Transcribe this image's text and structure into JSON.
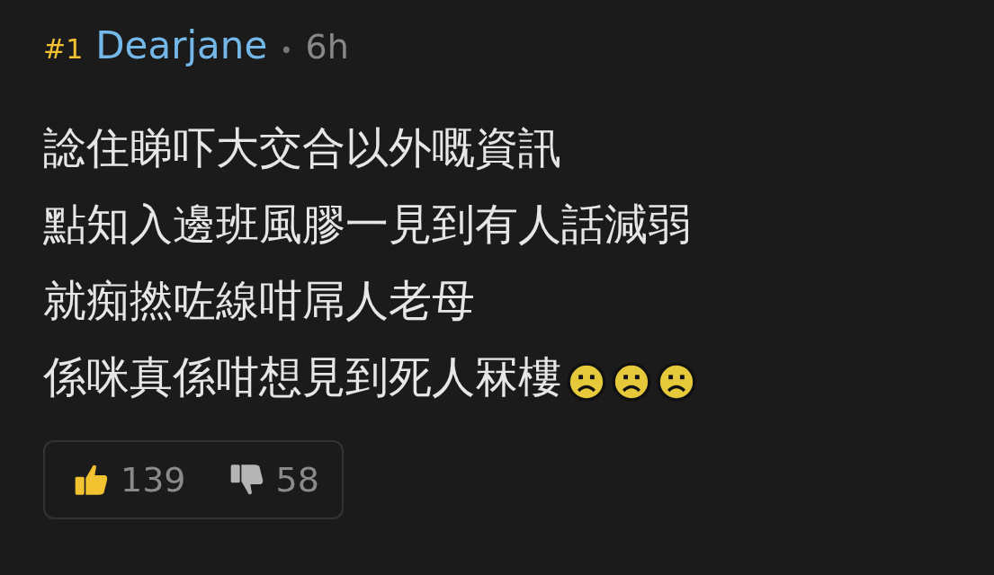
{
  "post": {
    "number": "#1",
    "author": "Dearjane",
    "separator": "•",
    "time": "6h",
    "lines": [
      {
        "text": "諗住睇吓大交合以外嘅資訊"
      },
      {
        "text": "點知入邊班風膠一見到有人話減弱"
      },
      {
        "text": "就痴撚咗線咁屌人老母"
      },
      {
        "text": "係咪真係咁想見到死人冧樓",
        "emoticons": [
          {
            "kind": "sad"
          },
          {
            "kind": "sad"
          },
          {
            "kind": "sad"
          }
        ]
      }
    ],
    "votes": {
      "up": "139",
      "down": "58"
    }
  }
}
